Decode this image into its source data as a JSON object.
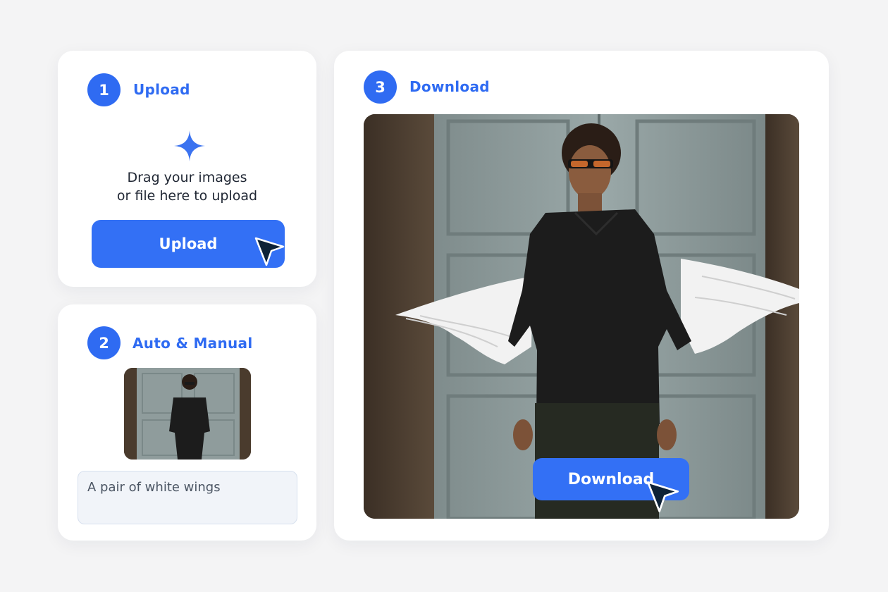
{
  "steps": {
    "upload": {
      "number": "1",
      "title": "Upload"
    },
    "auto": {
      "number": "2",
      "title": "Auto & Manual"
    },
    "download": {
      "number": "3",
      "title": "Download"
    }
  },
  "upload_card": {
    "drop_line1": "Drag your images",
    "drop_line2": "or file here to upload",
    "button_label": "Upload"
  },
  "auto_card": {
    "prompt_value": "A pair of white wings"
  },
  "download_card": {
    "button_label": "Download"
  },
  "colors": {
    "accent": "#2f6bf2",
    "button": "#3370f5",
    "background": "#f4f4f5",
    "cursor": "#0d2238"
  },
  "icons": {
    "add": "plus-sparkle-icon",
    "pointer": "cursor-arrow-icon"
  }
}
